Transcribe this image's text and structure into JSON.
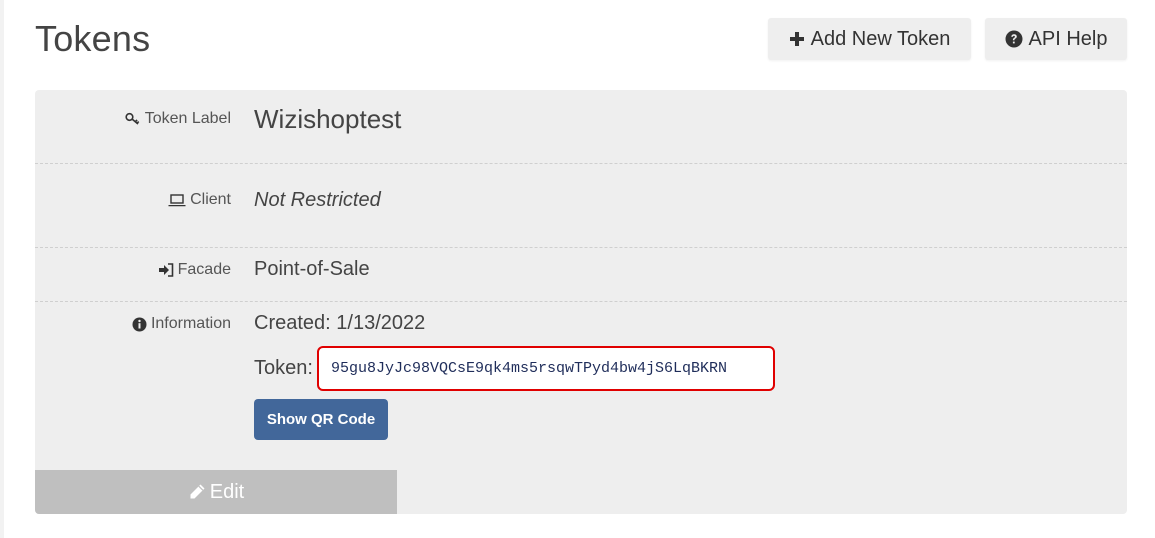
{
  "page": {
    "title": "Tokens"
  },
  "header": {
    "add_token_label": "Add New Token",
    "add_token_icon": "plus-icon",
    "api_help_label": "API Help",
    "api_help_icon": "question-circle-icon"
  },
  "token": {
    "fields": {
      "label": {
        "name": "Token Label",
        "icon": "key-icon",
        "value": "Wizishoptest"
      },
      "client": {
        "name": "Client",
        "icon": "laptop-icon",
        "value": "Not Restricted"
      },
      "facade": {
        "name": "Facade",
        "icon": "sign-in-icon",
        "value": "Point-of-Sale"
      },
      "information": {
        "name": "Information",
        "icon": "info-circle-icon",
        "created": "Created: 1/13/2022",
        "token_label": "Token:",
        "token_value": "95gu8JyJc98VQCsE9qk4ms5rsqwTPyd4bw4jS6LqBKRN"
      }
    },
    "show_qr_label": "Show QR Code",
    "edit_label": "Edit",
    "edit_icon": "pencil-icon"
  },
  "colors": {
    "card_background": "#eeeeee",
    "primary_button": "#42679a",
    "edit_button": "#bfbfbf",
    "highlight_border": "#e00000",
    "token_text": "#1f2d5a"
  }
}
